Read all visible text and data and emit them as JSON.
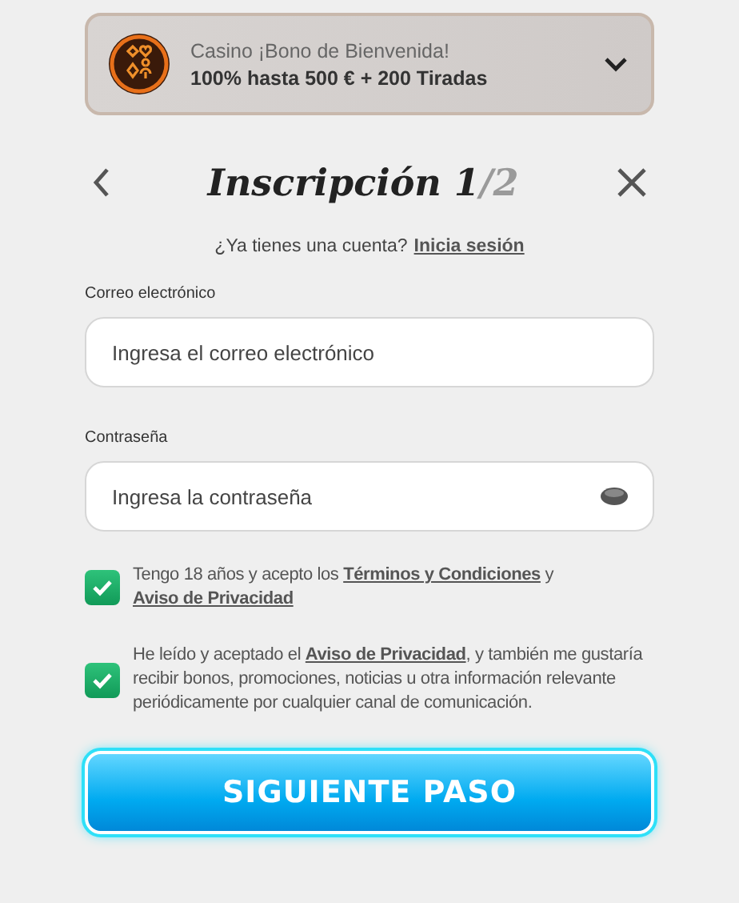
{
  "bonus_banner": {
    "title": "Casino ¡Bono de Bienvenida!",
    "offer": "100% hasta 500 € + 200 Tiradas",
    "expanded": false
  },
  "header": {
    "title": "Inscripción 1",
    "step_rest": "/2"
  },
  "login_prompt": {
    "text": "¿Ya tienes una cuenta?",
    "link": "Inicia sesión"
  },
  "fields": [
    {
      "label": "Correo electrónico",
      "placeholder": "Ingresa el correo electrónico",
      "kind": "email"
    },
    {
      "label": "Contraseña",
      "placeholder": "Ingresa la contraseña",
      "kind": "password"
    }
  ],
  "consents": [
    {
      "checked": true,
      "parts": [
        {
          "text": "Tengo 18 años y acepto los ",
          "link": false
        },
        {
          "text": "Términos y Condiciones",
          "link": true
        },
        {
          "text": " y ",
          "link": false
        },
        {
          "text": "Aviso de Privacidad",
          "link": true
        }
      ]
    },
    {
      "checked": true,
      "parts": [
        {
          "text": "He leído y aceptado el ",
          "link": false
        },
        {
          "text": "Aviso de Privacidad",
          "link": true
        },
        {
          "text": ", y también me gustaría recibir bonos, promociones, noticias u otra información relevante periódicamente por cualquier canal de comunicación.",
          "link": false
        }
      ]
    }
  ],
  "submit": "SIGUIENTE PASO"
}
